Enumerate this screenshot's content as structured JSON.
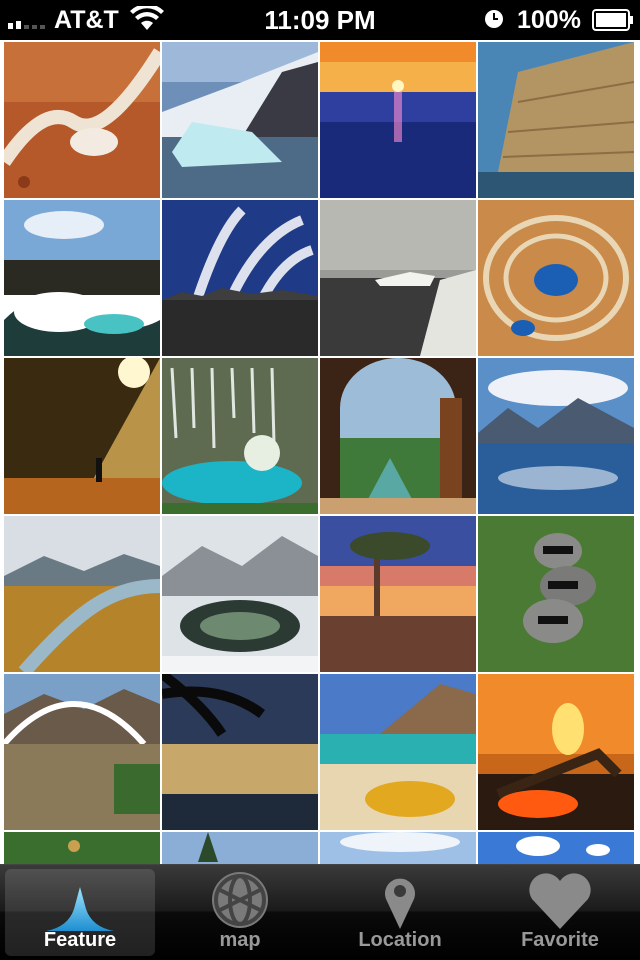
{
  "status_bar": {
    "carrier": "AT&T",
    "time": "11:09 PM",
    "battery": "100%",
    "icons": [
      "signal-icon",
      "wifi-icon",
      "alarm-icon",
      "battery-icon"
    ]
  },
  "grid": {
    "columns": 4,
    "photos": [
      {
        "subject": "desert sand trail"
      },
      {
        "subject": "iceberg and snowy mountain"
      },
      {
        "subject": "sunset over ocean"
      },
      {
        "subject": "sea cliff"
      },
      {
        "subject": "waves on lava coast"
      },
      {
        "subject": "basalt columns under sky"
      },
      {
        "subject": "misty shore"
      },
      {
        "subject": "ring lake aerial"
      },
      {
        "subject": "sunbeams in forest"
      },
      {
        "subject": "cenote cave"
      },
      {
        "subject": "open window to lake"
      },
      {
        "subject": "mountain lake reflection"
      },
      {
        "subject": "valley river"
      },
      {
        "subject": "winter stream"
      },
      {
        "subject": "lone tree at dusk"
      },
      {
        "subject": "raccoons"
      },
      {
        "subject": "arch bridge"
      },
      {
        "subject": "palm silhouette sunset"
      },
      {
        "subject": "beach with fallen leaves"
      },
      {
        "subject": "campfire at sunset"
      },
      {
        "subject": "trees"
      },
      {
        "subject": "pine under sky"
      },
      {
        "subject": "clouds"
      },
      {
        "subject": "blue sky clouds"
      }
    ]
  },
  "tab_bar": {
    "tabs": [
      {
        "label": "Feature",
        "icon": "feature-icon",
        "selected": true
      },
      {
        "label": "map",
        "icon": "globe-icon",
        "selected": false
      },
      {
        "label": "Location",
        "icon": "location-pin-icon",
        "selected": false
      },
      {
        "label": "Favorite",
        "icon": "heart-icon",
        "selected": false
      }
    ]
  },
  "colors": {
    "feature_accent": "#5fc8f0",
    "tab_inactive": "#999999"
  }
}
